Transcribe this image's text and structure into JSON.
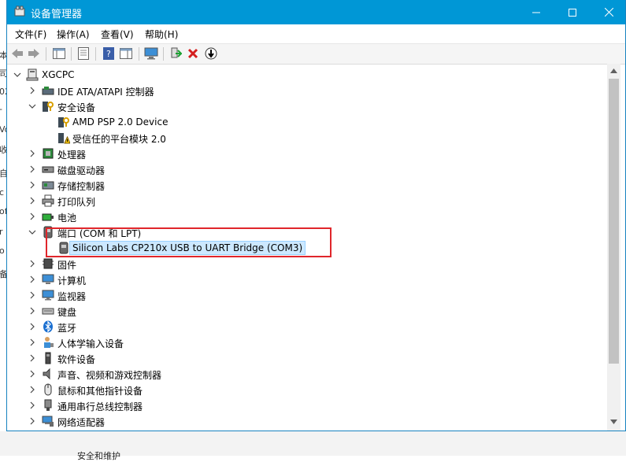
{
  "window": {
    "title": "设备管理器"
  },
  "menu": [
    "文件(F)",
    "操作(A)",
    "查看(V)",
    "帮助(H)"
  ],
  "toolbar": [
    "back-arrow-icon",
    "forward-arrow-icon",
    "show-hide-tree-icon",
    "properties-icon",
    "help-icon",
    "action-pane-icon",
    "monitor-scan-icon",
    "enable-driver-icon",
    "uninstall-icon",
    "update-driver-icon"
  ],
  "tree": {
    "root": "XGCPC",
    "items": [
      {
        "label": "IDE ATA/ATAPI 控制器",
        "icon": "ide-controller-icon"
      },
      {
        "label": "安全设备",
        "icon": "security-device-icon",
        "expanded": true,
        "children": [
          {
            "label": "AMD PSP 2.0 Device"
          },
          {
            "label": "受信任的平台模块 2.0"
          }
        ]
      },
      {
        "label": "处理器",
        "icon": "processor-icon"
      },
      {
        "label": "磁盘驱动器",
        "icon": "disk-drive-icon"
      },
      {
        "label": "存储控制器",
        "icon": "storage-controller-icon"
      },
      {
        "label": "打印队列",
        "icon": "printer-icon"
      },
      {
        "label": "电池",
        "icon": "battery-icon"
      },
      {
        "label": "端口 (COM 和 LPT)",
        "icon": "port-icon",
        "expanded": true,
        "children": [
          {
            "label": "Silicon Labs CP210x USB to UART Bridge (COM3)",
            "selected": true
          }
        ]
      },
      {
        "label": "固件",
        "icon": "firmware-icon"
      },
      {
        "label": "计算机",
        "icon": "computer-icon"
      },
      {
        "label": "监视器",
        "icon": "monitor-icon"
      },
      {
        "label": "键盘",
        "icon": "keyboard-icon"
      },
      {
        "label": "蓝牙",
        "icon": "bluetooth-icon"
      },
      {
        "label": "人体学输入设备",
        "icon": "hid-icon"
      },
      {
        "label": "软件设备",
        "icon": "software-device-icon"
      },
      {
        "label": "声音、视频和游戏控制器",
        "icon": "sound-icon"
      },
      {
        "label": "鼠标和其他指针设备",
        "icon": "mouse-icon"
      },
      {
        "label": "通用串行总线控制器",
        "icon": "usb-icon"
      },
      {
        "label": "网络适配器",
        "icon": "network-adapter-icon"
      }
    ]
  },
  "colors": {
    "titlebar": "#0097d6",
    "highlight": "#e0262b",
    "selection": "#cce8ff"
  }
}
